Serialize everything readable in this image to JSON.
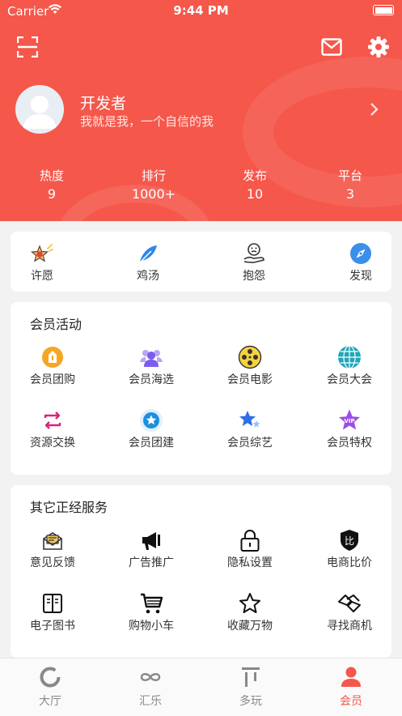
{
  "status_bar": {
    "carrier": "Carrier",
    "time": "9:44 PM"
  },
  "profile": {
    "name": "开发者",
    "motto": "我就是我，一个自信的我"
  },
  "stats": [
    {
      "label": "热度",
      "value": "9"
    },
    {
      "label": "排行",
      "value": "1000+"
    },
    {
      "label": "发布",
      "value": "10"
    },
    {
      "label": "平台",
      "value": "3"
    }
  ],
  "quick_actions": [
    {
      "label": "许愿",
      "icon": "wish-icon"
    },
    {
      "label": "鸡汤",
      "icon": "feather-icon"
    },
    {
      "label": "抱怨",
      "icon": "complain-icon"
    },
    {
      "label": "发现",
      "icon": "compass-icon"
    }
  ],
  "member_section": {
    "title": "会员活动",
    "items": [
      {
        "label": "会员团购",
        "icon": "group-buy-icon"
      },
      {
        "label": "会员海选",
        "icon": "audition-icon"
      },
      {
        "label": "会员电影",
        "icon": "film-reel-icon"
      },
      {
        "label": "会员大会",
        "icon": "globe-icon"
      },
      {
        "label": "资源交换",
        "icon": "exchange-icon"
      },
      {
        "label": "会员团建",
        "icon": "team-star-icon"
      },
      {
        "label": "会员综艺",
        "icon": "stars-icon"
      },
      {
        "label": "会员特权",
        "icon": "vip-star-icon"
      }
    ]
  },
  "services_section": {
    "title": "其它正经服务",
    "items": [
      {
        "label": "意见反馈",
        "icon": "mail-open-icon"
      },
      {
        "label": "广告推广",
        "icon": "megaphone-icon"
      },
      {
        "label": "隐私设置",
        "icon": "lock-icon"
      },
      {
        "label": "电商比价",
        "icon": "compare-shield-icon"
      },
      {
        "label": "电子图书",
        "icon": "book-icon"
      },
      {
        "label": "购物小车",
        "icon": "cart-icon"
      },
      {
        "label": "收藏万物",
        "icon": "star-outline-icon"
      },
      {
        "label": "寻找商机",
        "icon": "handshake-icon"
      }
    ]
  },
  "tabbar": [
    {
      "label": "大厅",
      "icon": "ring-icon"
    },
    {
      "label": "汇乐",
      "icon": "infinity-icon"
    },
    {
      "label": "多玩",
      "icon": "bars-icon"
    },
    {
      "label": "会员",
      "icon": "person-icon",
      "active": true
    }
  ],
  "colors": {
    "brand": "#f5574b",
    "card": "#ffffff",
    "background": "#f2f2f2",
    "tab_inactive": "#8a8a8a"
  }
}
